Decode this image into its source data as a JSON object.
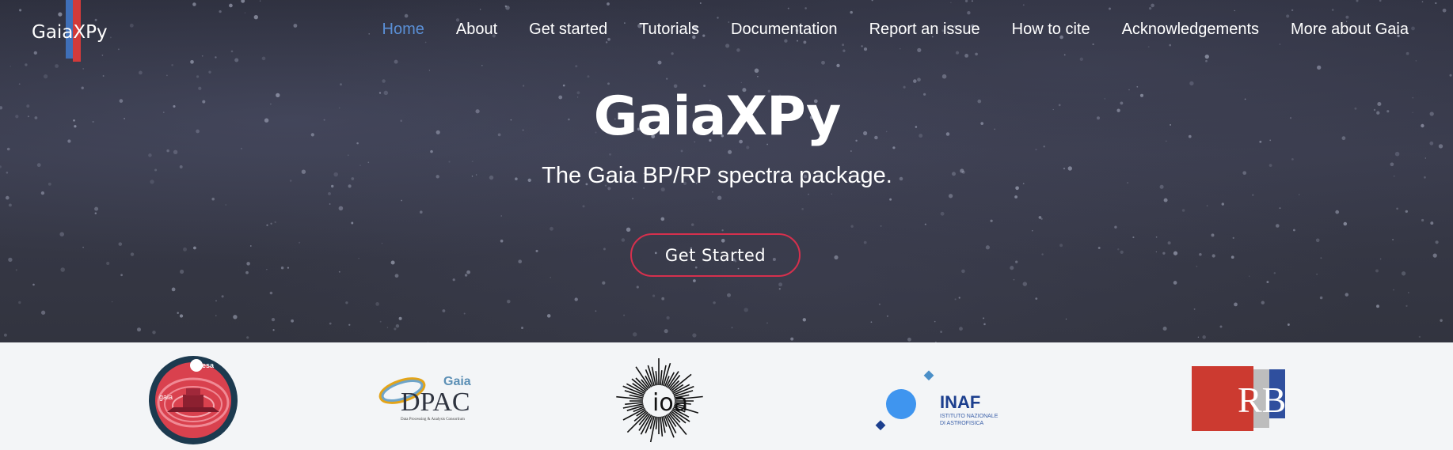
{
  "logo": {
    "text": "GaiaXPy",
    "colors": {
      "blue": "#3f6fb8",
      "red": "#d23a3a"
    }
  },
  "nav": {
    "items": [
      {
        "label": "Home",
        "active": true
      },
      {
        "label": "About",
        "active": false
      },
      {
        "label": "Get started",
        "active": false
      },
      {
        "label": "Tutorials",
        "active": false
      },
      {
        "label": "Documentation",
        "active": false
      },
      {
        "label": "Report an issue",
        "active": false
      },
      {
        "label": "How to cite",
        "active": false
      },
      {
        "label": "Acknowledgements",
        "active": false
      },
      {
        "label": "More about Gaia",
        "active": false
      }
    ],
    "active_color": "#5a8fd6"
  },
  "hero": {
    "title": "GaiaXPy",
    "subtitle": "The Gaia BP/RP spectra package.",
    "cta_label": "Get Started",
    "cta_border_color": "#d6304d"
  },
  "partners": {
    "esa": {
      "badge": "esa",
      "label": "gaia",
      "icon": "esa-gaia-mission-logo"
    },
    "dpac": {
      "top": "Gaia",
      "main": "DPAC",
      "small": "Data Processing & Analysis Consortium",
      "icon": "dpac-logo"
    },
    "ioa": {
      "text": "ioa",
      "icon": "ioa-sunburst-logo"
    },
    "inaf": {
      "main": "INAF",
      "line1": "ISTITUTO NAZIONALE",
      "line2": "DI ASTROFISICA",
      "icon": "inaf-logo"
    },
    "rb": {
      "text": "RB",
      "icon": "rb-logo"
    }
  }
}
